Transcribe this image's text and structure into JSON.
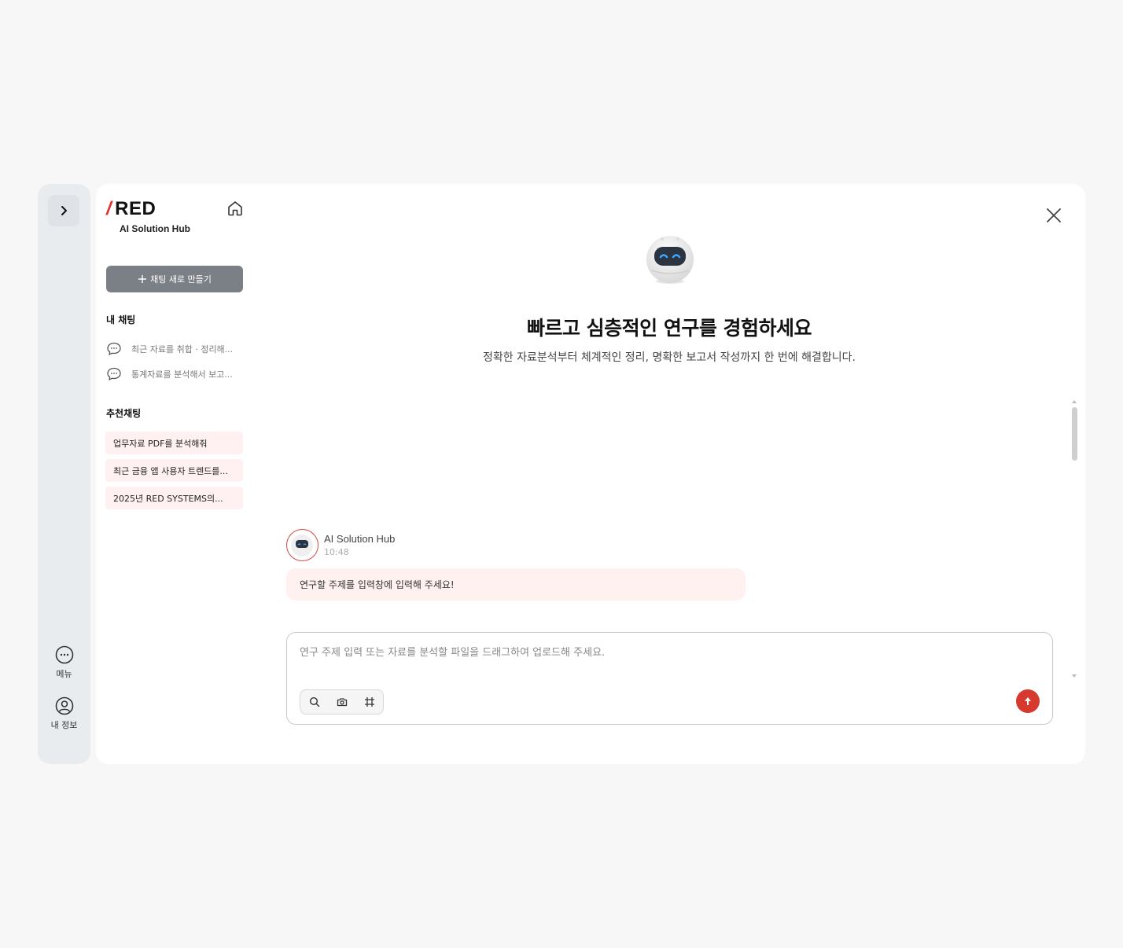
{
  "brand": {
    "logo_text": "RED",
    "subtitle": "AI Solution Hub"
  },
  "rail": {
    "menu_label": "메뉴",
    "profile_label": "내 정보"
  },
  "sidebar": {
    "new_chat_label": "채팅 새로 만들기",
    "my_chats_title": "내 채팅",
    "my_chats": [
      {
        "label": "최근 자료를 취합 · 정리해..."
      },
      {
        "label": "통계자료를 분석해서 보고..."
      }
    ],
    "recommended_title": "추천채팅",
    "recommended": [
      {
        "label": "업무자료 PDF를 분석해줘"
      },
      {
        "label": "최근 금융 앱 사용자 트렌드를..."
      },
      {
        "label": "2025년 RED SYSTEMS의..."
      }
    ]
  },
  "hero": {
    "title": "빠르고 심층적인 연구를 경험하세요",
    "subtitle": "정확한 자료분석부터 체계적인 정리, 명확한 보고서 작성까지 한 번에 해결합니다."
  },
  "message": {
    "sender": "AI Solution Hub",
    "time": "10:48",
    "text": "연구할 주제를 입력창에 입력해 주세요!"
  },
  "composer": {
    "placeholder": "연구 주제 입력 또는 자료를 분석할 파일을 드래그하여 업로드해 주세요.",
    "value": ""
  },
  "colors": {
    "accent": "#d63a2f",
    "recommend_bg": "#fff1f1",
    "new_chat_bg": "#7b7f86",
    "rail_bg": "#e9ecef"
  },
  "icons": [
    "chevron-right-icon",
    "home-icon",
    "plus-icon",
    "chat-bubble-icon",
    "more-icon",
    "user-icon",
    "close-icon",
    "search-icon",
    "camera-icon",
    "crop-icon",
    "arrow-up-icon"
  ]
}
